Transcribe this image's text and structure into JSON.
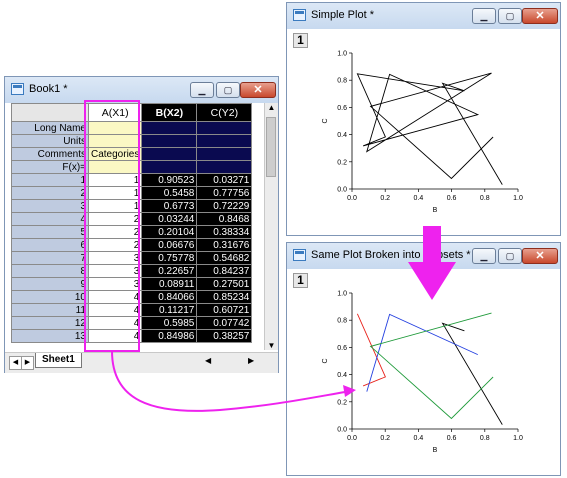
{
  "book": {
    "title": "Book1 *",
    "columns": [
      "A(X1)",
      "B(X2)",
      "C(Y2)"
    ],
    "meta_rows": [
      "Long Name",
      "Units",
      "Comments",
      "F(x)="
    ],
    "comments_A": "Categories",
    "rows": [
      {
        "n": "1",
        "a": "1",
        "b": "0.90523",
        "c": "0.03271"
      },
      {
        "n": "2",
        "a": "1",
        "b": "0.5458",
        "c": "0.77756"
      },
      {
        "n": "3",
        "a": "1",
        "b": "0.6773",
        "c": "0.72229"
      },
      {
        "n": "4",
        "a": "2",
        "b": "0.03244",
        "c": "0.8468"
      },
      {
        "n": "5",
        "a": "2",
        "b": "0.20104",
        "c": "0.38334"
      },
      {
        "n": "6",
        "a": "2",
        "b": "0.06676",
        "c": "0.31676"
      },
      {
        "n": "7",
        "a": "3",
        "b": "0.75778",
        "c": "0.54682"
      },
      {
        "n": "8",
        "a": "3",
        "b": "0.22657",
        "c": "0.84237"
      },
      {
        "n": "9",
        "a": "3",
        "b": "0.08911",
        "c": "0.27501"
      },
      {
        "n": "10",
        "a": "4",
        "b": "0.84066",
        "c": "0.85234"
      },
      {
        "n": "11",
        "a": "4",
        "b": "0.11217",
        "c": "0.60721"
      },
      {
        "n": "12",
        "a": "4",
        "b": "0.5985",
        "c": "0.07742"
      },
      {
        "n": "13",
        "a": "4",
        "b": "0.84986",
        "c": "0.38257"
      }
    ],
    "sheet_tab": "Sheet1"
  },
  "plot1": {
    "title": "Simple Plot *",
    "layer": "1",
    "xlabel": "B",
    "ylabel": "C",
    "xticks": [
      "0.0",
      "0.2",
      "0.4",
      "0.6",
      "0.8",
      "1.0"
    ],
    "yticks": [
      "0.0",
      "0.2",
      "0.4",
      "0.6",
      "0.8",
      "1.0"
    ]
  },
  "plot2": {
    "title": "Same Plot Broken into Subsets *",
    "layer": "1",
    "xlabel": "B",
    "ylabel": "C",
    "xticks": [
      "0.0",
      "0.2",
      "0.4",
      "0.6",
      "0.8",
      "1.0"
    ],
    "yticks": [
      "0.0",
      "0.2",
      "0.4",
      "0.6",
      "0.8",
      "1.0"
    ]
  },
  "chart_data": [
    {
      "type": "line",
      "series": [
        {
          "x": [
            0.90523,
            0.5458,
            0.6773,
            0.03244,
            0.20104,
            0.06676,
            0.75778,
            0.22657,
            0.08911,
            0.84066,
            0.11217,
            0.5985,
            0.84986
          ],
          "y": [
            0.03271,
            0.77756,
            0.72229,
            0.8468,
            0.38334,
            0.31676,
            0.54682,
            0.84237,
            0.27501,
            0.85234,
            0.60721,
            0.07742,
            0.38257
          ],
          "color": "#000000"
        }
      ],
      "xlim": [
        0,
        1
      ],
      "ylim": [
        0,
        1
      ]
    },
    {
      "type": "line",
      "series": [
        {
          "x": [
            0.90523,
            0.5458,
            0.6773
          ],
          "y": [
            0.03271,
            0.77756,
            0.72229
          ],
          "color": "#000000"
        },
        {
          "x": [
            0.03244,
            0.20104,
            0.06676
          ],
          "y": [
            0.8468,
            0.38334,
            0.31676
          ],
          "color": "#e8231c"
        },
        {
          "x": [
            0.75778,
            0.22657,
            0.08911
          ],
          "y": [
            0.54682,
            0.84237,
            0.27501
          ],
          "color": "#2440e0"
        },
        {
          "x": [
            0.84066,
            0.11217,
            0.5985,
            0.84986
          ],
          "y": [
            0.85234,
            0.60721,
            0.07742,
            0.38257
          ],
          "color": "#1f9a3a"
        }
      ],
      "xlim": [
        0,
        1
      ],
      "ylim": [
        0,
        1
      ]
    }
  ],
  "colors": {
    "highlight": "#ee22ee",
    "arrow": "#ee22ee"
  }
}
